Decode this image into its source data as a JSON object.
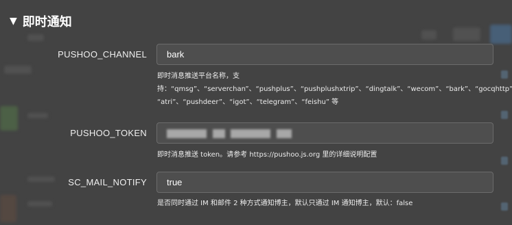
{
  "section": {
    "arrow": "▼",
    "title": "即时通知"
  },
  "fields": [
    {
      "label": "PUSHOO_CHANNEL",
      "value": "bark",
      "help_line1": "即时消息推送平台名称，支",
      "help_line2": "持：“qmsg”、“serverchan”、“pushplus”、“pushplushxtrip”、“dingtalk”、“wecom”、“bark”、“gocqhttp”、",
      "help_line3": "“atri”、“pushdeer”、“igot”、“telegram”、“feishu” 等"
    },
    {
      "label": "PUSHOO_TOKEN",
      "value": "",
      "help_line1": "即时消息推送 token。请参考 https://pushoo.js.org 里的详细说明配置"
    },
    {
      "label": "SC_MAIL_NOTIFY",
      "value": "true",
      "help_line1": "是否同时通过 IM 和邮件 2 种方式通知博主，默认只通过 IM 通知博主，默认：false"
    }
  ],
  "colors": {
    "background": "#4a4a4a",
    "text": "#ffffff",
    "input_border": "#6c6c6c"
  }
}
